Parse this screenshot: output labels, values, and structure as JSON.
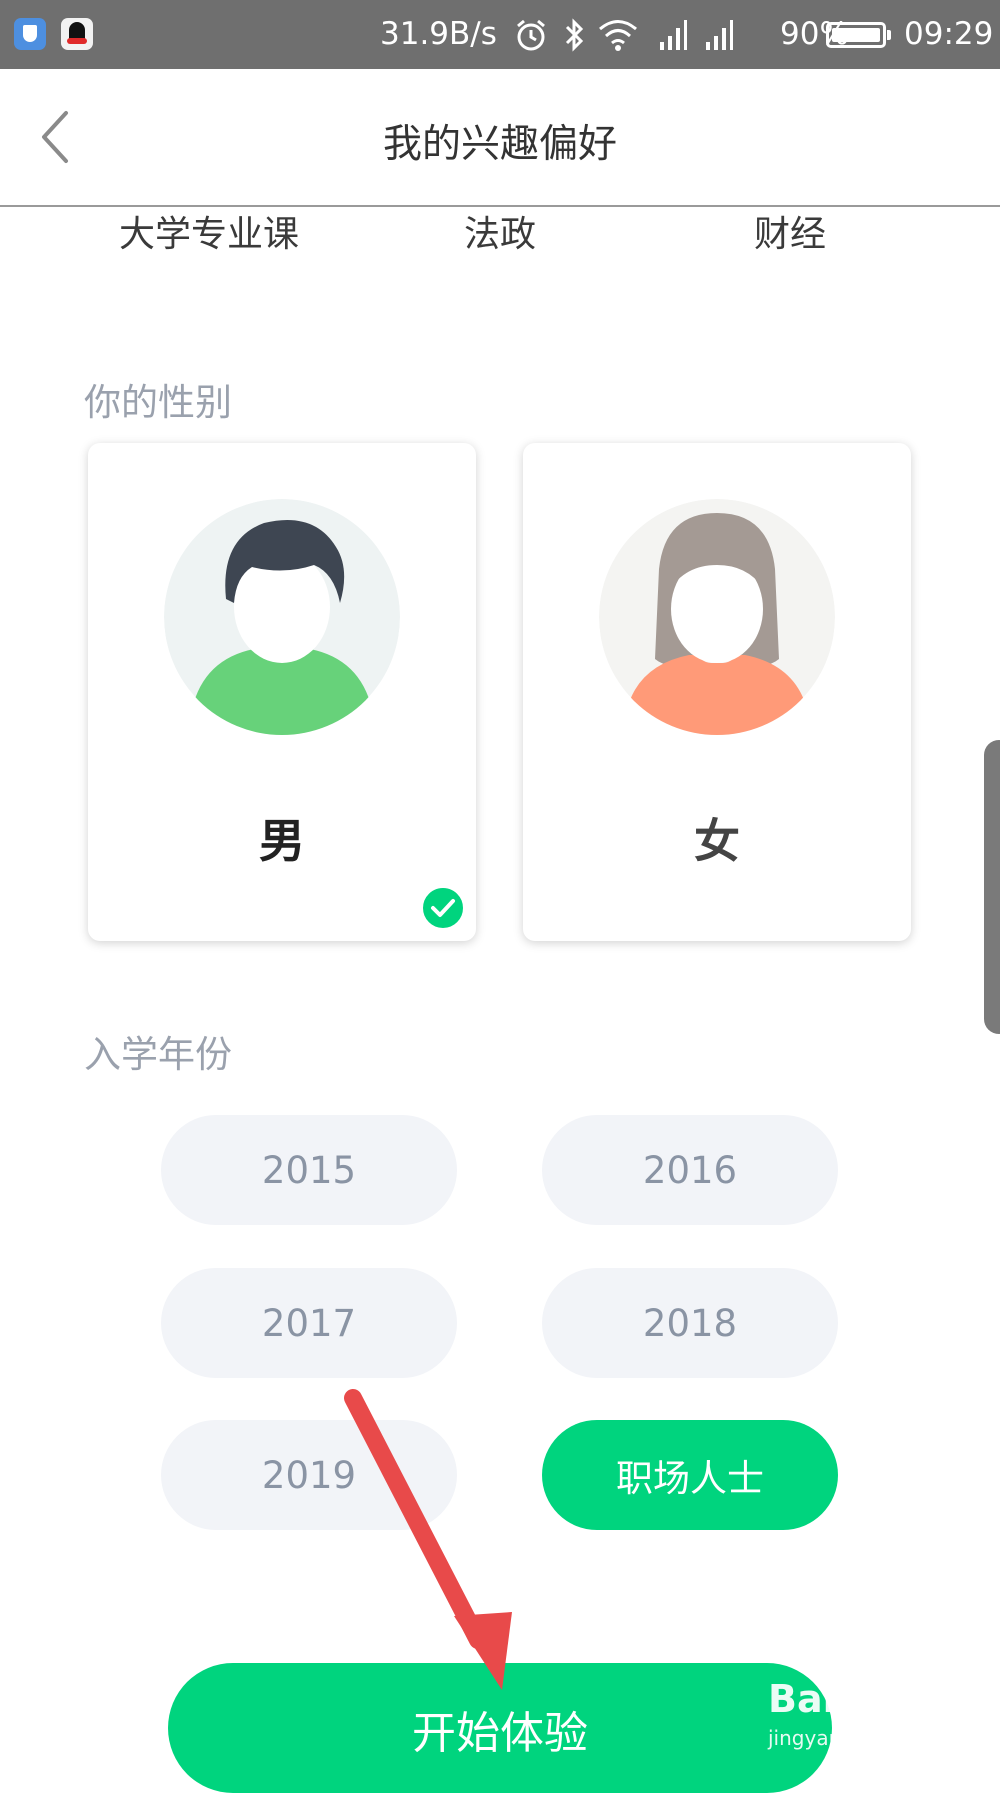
{
  "status_bar": {
    "net_speed": "31.9B/s",
    "battery_percent": "90%",
    "time": "09:29",
    "icons": [
      "shield-app-icon",
      "qq-app-icon",
      "alarm-icon",
      "bluetooth-icon",
      "wifi-icon",
      "signal-icon",
      "signal-icon",
      "battery-icon"
    ]
  },
  "nav": {
    "back_icon": "chevron-left-icon",
    "title": "我的兴趣偏好"
  },
  "interests": [
    "大学专业课",
    "法政",
    "财经"
  ],
  "gender_section": {
    "label": "你的性别",
    "options": [
      {
        "label": "男",
        "selected": true,
        "avatar": "male-avatar-icon"
      },
      {
        "label": "女",
        "selected": false,
        "avatar": "female-avatar-icon"
      }
    ]
  },
  "year_section": {
    "label": "入学年份",
    "options": [
      {
        "label": "2015",
        "selected": false
      },
      {
        "label": "2016",
        "selected": false
      },
      {
        "label": "2017",
        "selected": false
      },
      {
        "label": "2018",
        "selected": false
      },
      {
        "label": "2019",
        "selected": false
      },
      {
        "label": "职场人士",
        "selected": true
      }
    ]
  },
  "start_button": {
    "label": "开始体验"
  },
  "watermark": {
    "main": "Bai经验",
    "sub": "jingyan.baidu.com"
  },
  "colors": {
    "accent": "#00d47e",
    "pill_bg": "#f2f4f8",
    "pill_text": "#8a94a4",
    "annotation_arrow": "#e84a4a"
  }
}
